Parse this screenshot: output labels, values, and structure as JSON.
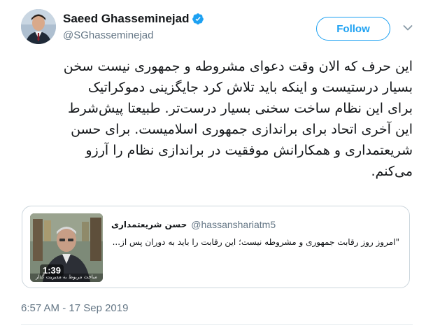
{
  "author": {
    "name": "Saeed Ghasseminejad",
    "handle": "@SGhasseminejad",
    "verified": true,
    "verified_color": "#1da1f2"
  },
  "follow_label": "Follow",
  "tweet_lines": [
    "این حرف که الان وقت دعوای مشروطه و جمهوری نیست سخن",
    "بسیار درستیست و اینکه باید تلاش کرد جایگزینی دموکراتیک",
    "برای این نظام ساخت سخنی بسیار درست‌تر. طبیعتا پیش‌شرط",
    "این آخری اتحاد برای براندازی جمهوری اسلامیست. برای حسن",
    "شریعتمداری و همکارانش موفقیت در براندازی نظام را آرزو",
    "می‌کنم."
  ],
  "quoted_tweet": {
    "name": "حسن شریعتمداری",
    "handle": "@hassanshariatm5",
    "text": "\"امروز روز رقابت جمهوری و مشروطه نیست؛ این رقابت را باید به دوران پس از...",
    "video_duration": "1:39",
    "video_caption": "مباحث مربوط به مدیریت گذار"
  },
  "timestamp": "6:57 AM - 17 Sep 2019",
  "colors": {
    "accent": "#1da1f2",
    "text": "#14171a",
    "secondary": "#657786",
    "border": "#ccd6dd"
  }
}
